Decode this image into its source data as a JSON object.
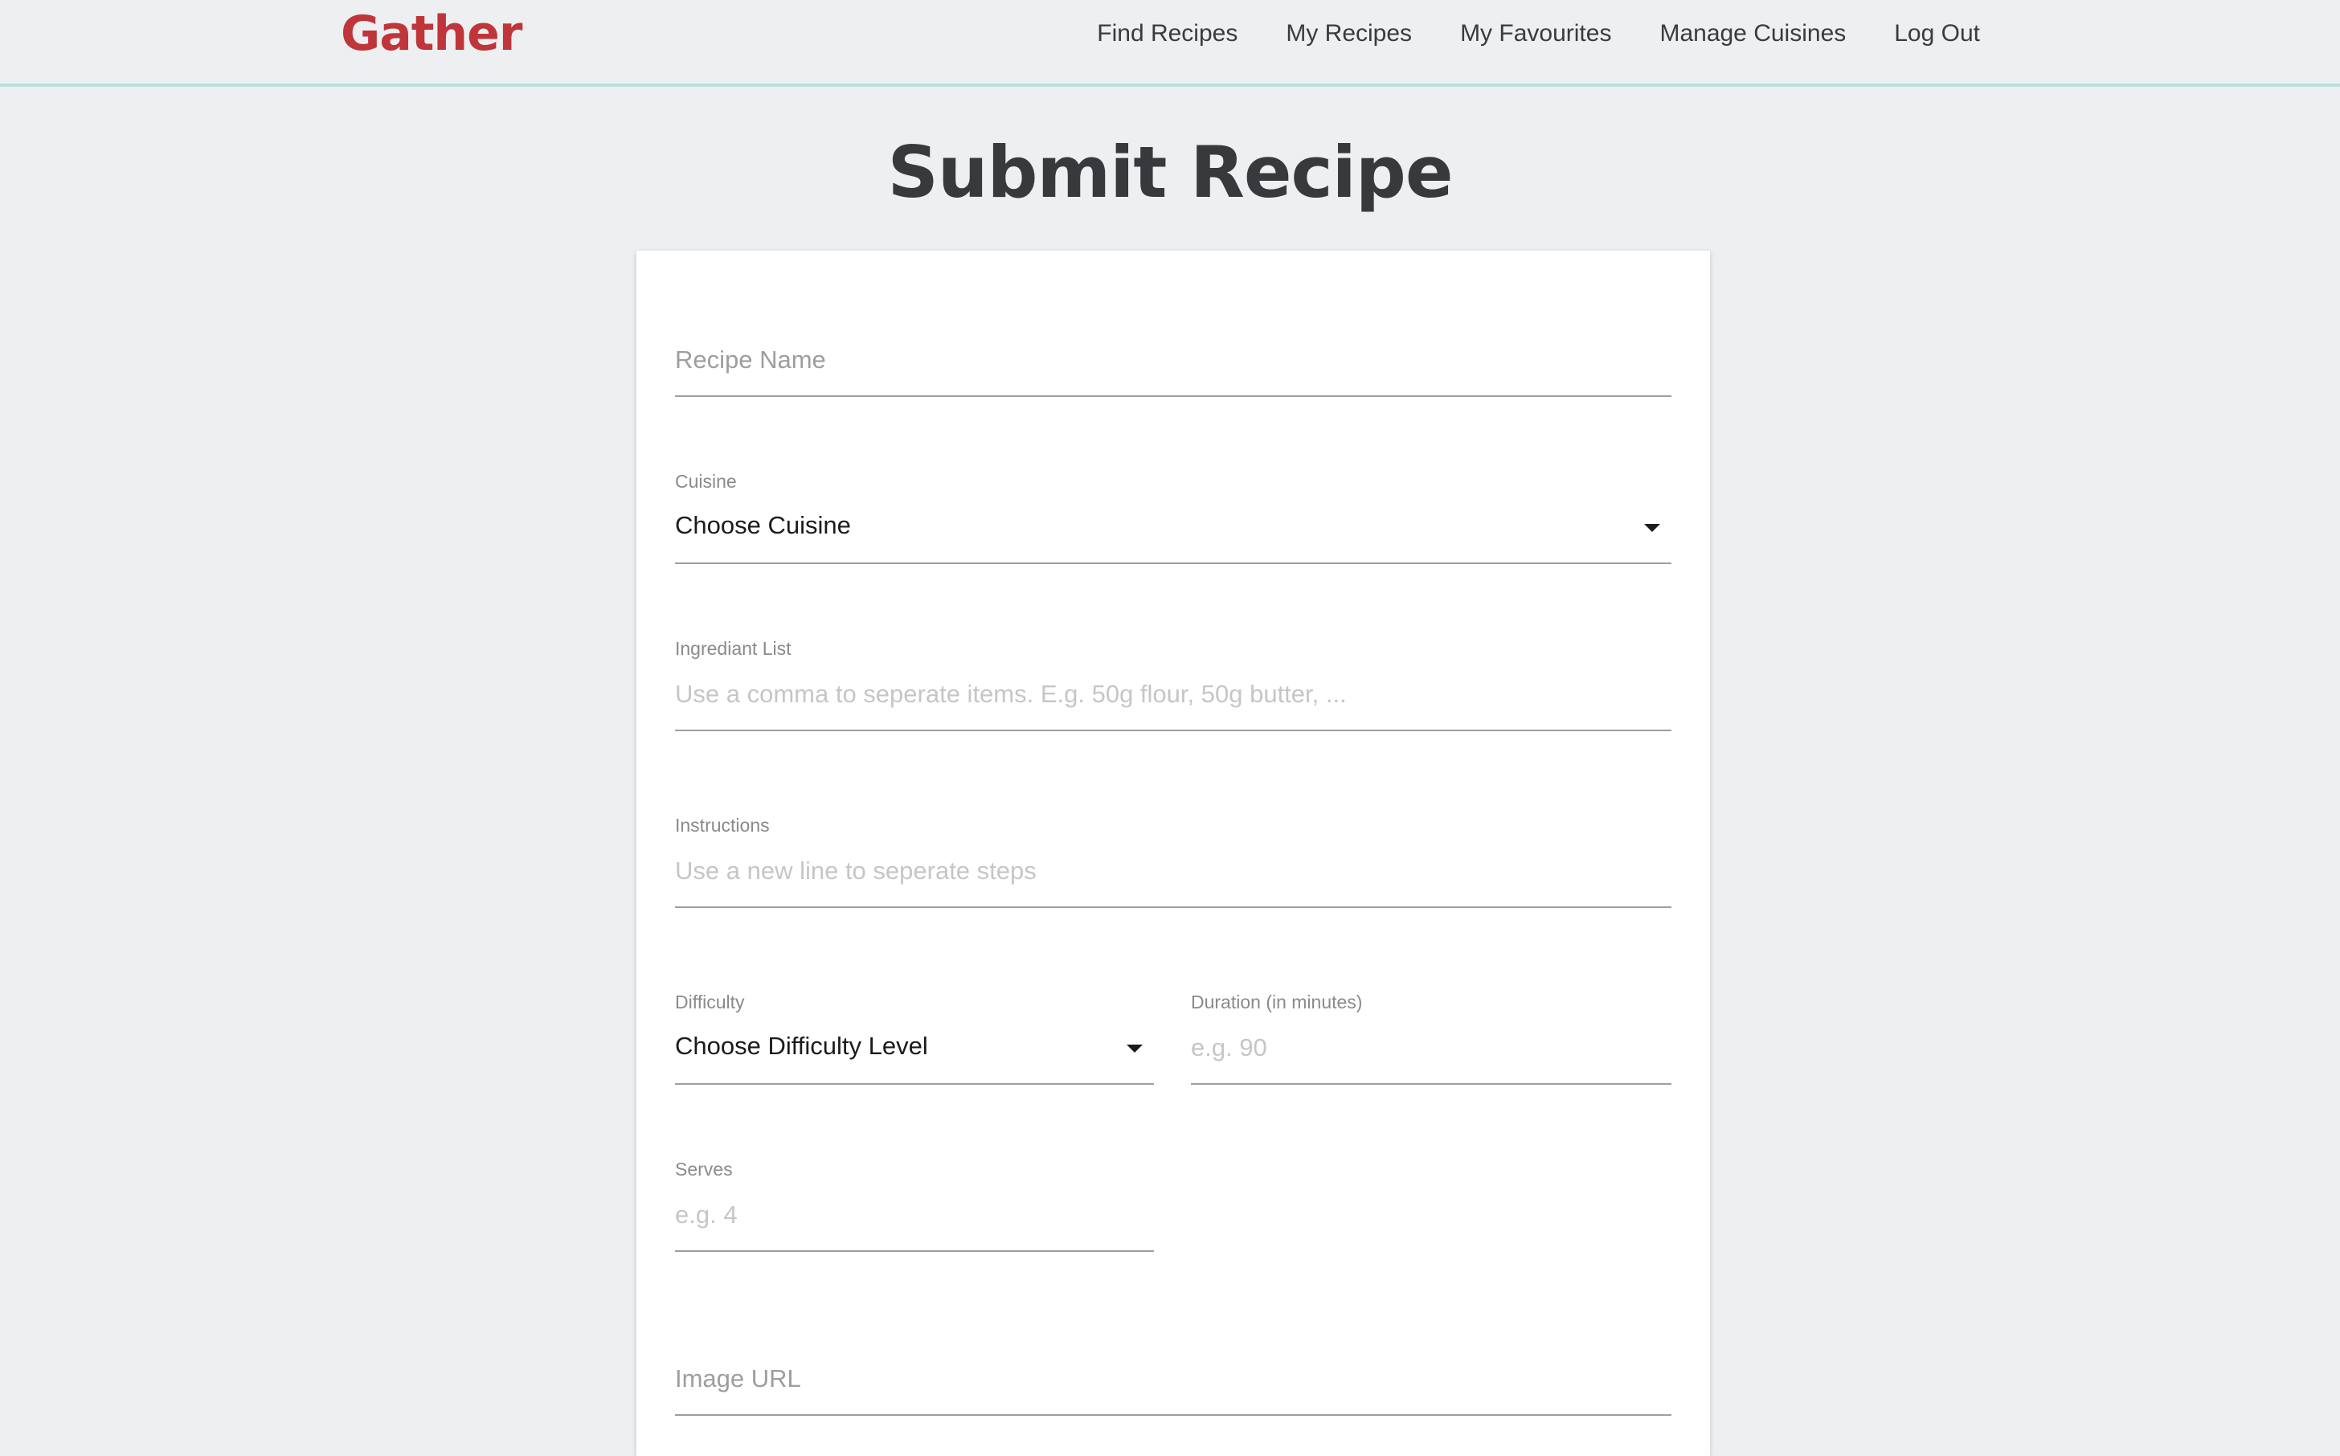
{
  "navbar": {
    "brand": "Gather",
    "links": [
      "Find Recipes",
      "My Recipes",
      "My Favourites",
      "Manage Cuisines",
      "Log Out"
    ]
  },
  "page": {
    "title": "Submit Recipe"
  },
  "form": {
    "recipe_name": {
      "placeholder": "Recipe Name"
    },
    "cuisine": {
      "label": "Cuisine",
      "value": "Choose Cuisine"
    },
    "ingredients": {
      "label": "Ingrediant List",
      "placeholder": "Use a comma to seperate items. E.g. 50g flour, 50g butter, ..."
    },
    "instructions": {
      "label": "Instructions",
      "placeholder": "Use a new line to seperate steps"
    },
    "difficulty": {
      "label": "Difficulty",
      "value": "Choose Difficulty Level"
    },
    "duration": {
      "label": "Duration (in minutes)",
      "placeholder": "e.g. 90"
    },
    "serves": {
      "label": "Serves",
      "placeholder": "e.g. 4"
    },
    "image_url": {
      "placeholder": "Image URL"
    }
  }
}
